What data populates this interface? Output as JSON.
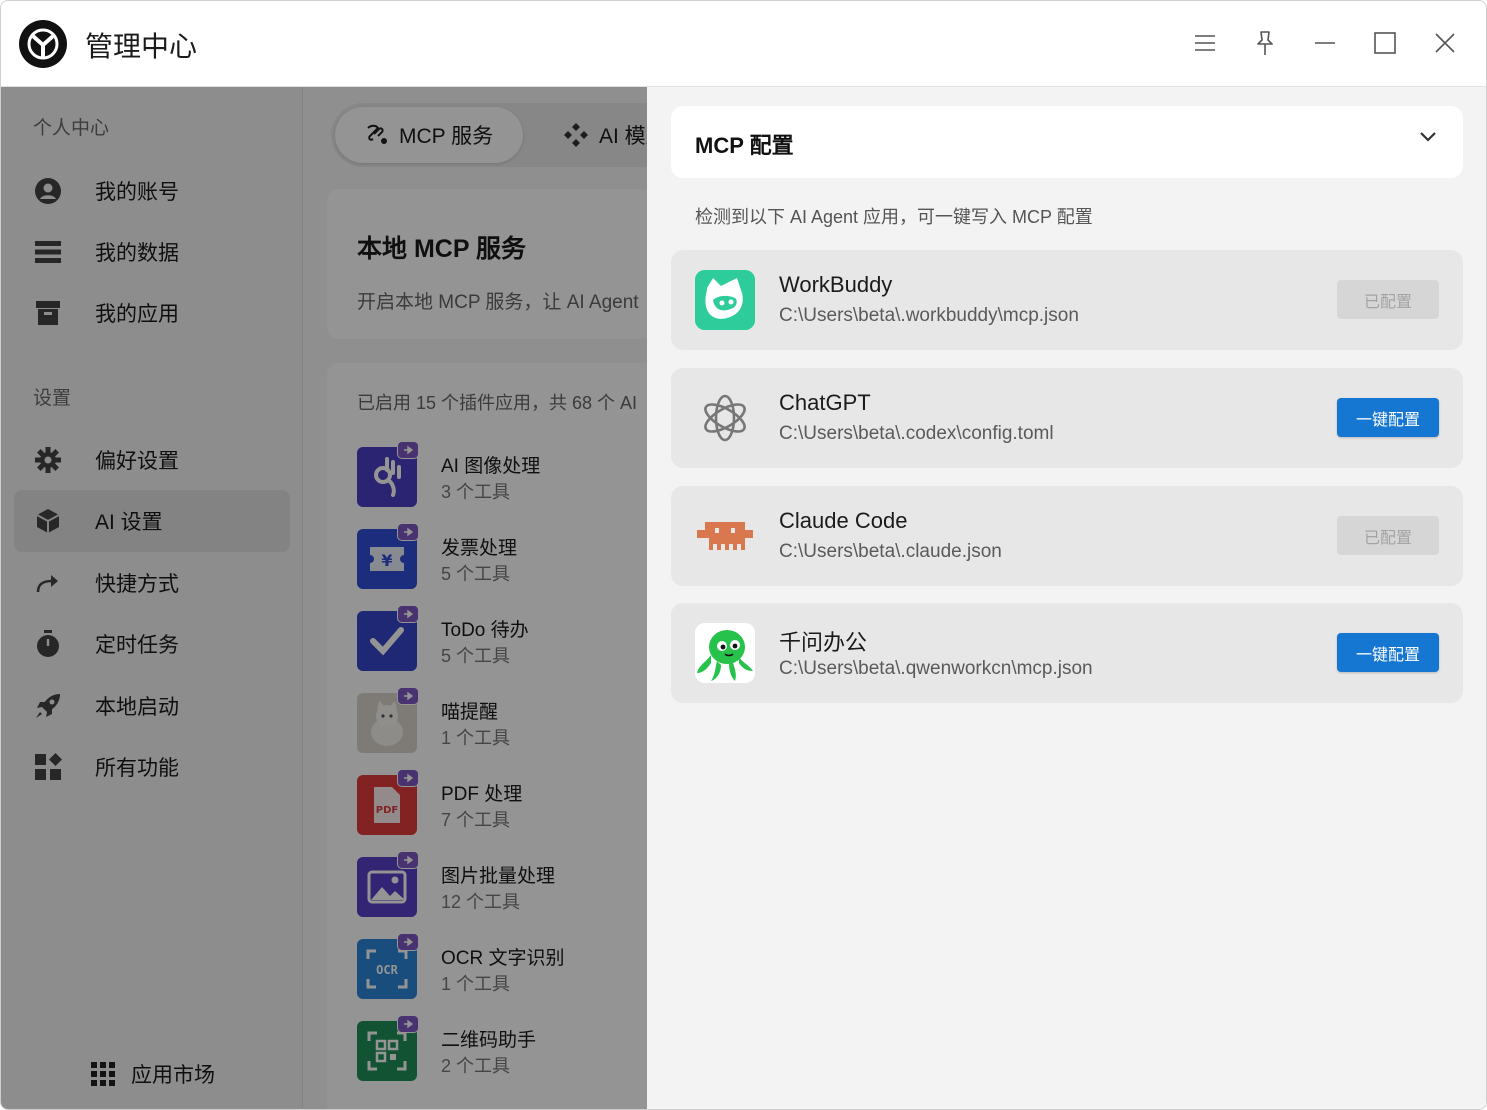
{
  "window": {
    "title": "管理中心"
  },
  "sidebar": {
    "personal_title": "个人中心",
    "settings_title": "设置",
    "items": [
      {
        "label": "我的账号",
        "icon": "account-icon"
      },
      {
        "label": "我的数据",
        "icon": "database-icon"
      },
      {
        "label": "我的应用",
        "icon": "archive-icon"
      },
      {
        "label": "偏好设置",
        "icon": "gear-icon"
      },
      {
        "label": "AI 设置",
        "icon": "cube-icon",
        "active": true
      },
      {
        "label": "快捷方式",
        "icon": "share-arrow-icon"
      },
      {
        "label": "定时任务",
        "icon": "timer-icon"
      },
      {
        "label": "本地启动",
        "icon": "rocket-icon"
      },
      {
        "label": "所有功能",
        "icon": "widgets-icon"
      }
    ],
    "market_label": "应用市场"
  },
  "main": {
    "tabs": [
      {
        "label": "MCP 服务",
        "active": true
      },
      {
        "label": "AI 模型"
      }
    ],
    "local_title": "本地 MCP 服务",
    "local_desc": "开启本地 MCP 服务，让 AI Agent",
    "summary": "已启用 15 个插件应用，共 68 个 AI",
    "plugins": [
      {
        "name": "AI 图像处理",
        "count": "3 个工具",
        "color": "#4a3fc4"
      },
      {
        "name": "发票处理",
        "count": "5 个工具",
        "color": "#2f4fd6"
      },
      {
        "name": "ToDo 待办",
        "count": "5 个工具",
        "color": "#3545c8"
      },
      {
        "name": "喵提醒",
        "count": "1 个工具",
        "color": "#d9d3cc"
      },
      {
        "name": "PDF 处理",
        "count": "7 个工具",
        "color": "#e03b3b"
      },
      {
        "name": "图片批量处理",
        "count": "12 个工具",
        "color": "#5b3fc8"
      },
      {
        "name": "OCR 文字识别",
        "count": "1 个工具",
        "color": "#2a86d8"
      },
      {
        "name": "二维码助手",
        "count": "2 个工具",
        "color": "#1f8f5a"
      }
    ]
  },
  "drawer": {
    "header": "MCP 配置",
    "hint": "检测到以下 AI Agent 应用，可一键写入 MCP 配置",
    "agents": [
      {
        "name": "WorkBuddy",
        "path": "C:\\Users\\beta\\.workbuddy\\mcp.json",
        "button": "已配置",
        "configured": true
      },
      {
        "name": "ChatGPT",
        "path": "C:\\Users\\beta\\.codex\\config.toml",
        "button": "一键配置",
        "configured": false
      },
      {
        "name": "Claude Code",
        "path": "C:\\Users\\beta\\.claude.json",
        "button": "已配置",
        "configured": true
      },
      {
        "name": "千问办公",
        "path": "C:\\Users\\beta\\.qwenworkcn\\mcp.json",
        "button": "一键配置",
        "configured": false
      }
    ]
  },
  "colors": {
    "accent": "#1677d2",
    "workbuddy": "#2ecc9a",
    "claude": "#d9774f",
    "qwen": "#27c24c"
  }
}
